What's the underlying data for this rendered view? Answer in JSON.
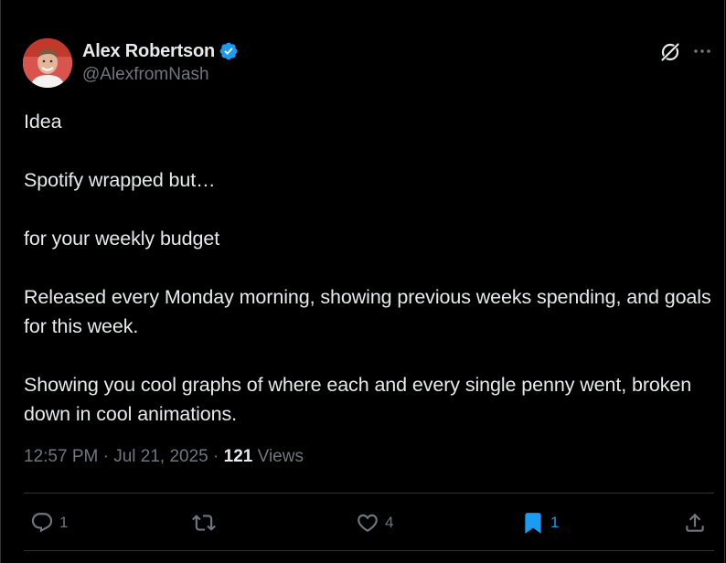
{
  "tweet": {
    "author": {
      "display_name": "Alex Robertson",
      "handle": "@AlexfromNash",
      "verified": true,
      "verified_color": "#1d9bf0"
    },
    "paragraphs": [
      "Idea",
      "Spotify wrapped but…",
      "for your weekly budget",
      "Released every Monday morning, showing previous weeks spending, and goals for this week.",
      "Showing you cool graphs of where each and every single penny went, broken down in cool animations."
    ],
    "time": "12:57 PM",
    "separator": "·",
    "date": "Jul 21, 2025",
    "views_count": "121",
    "views_label": "Views"
  },
  "header_icons": {
    "grok": "grok-icon",
    "more": "more-icon"
  },
  "actions": {
    "reply": {
      "icon": "reply-icon",
      "count": "1"
    },
    "repost": {
      "icon": "repost-icon",
      "count": ""
    },
    "like": {
      "icon": "heart-icon",
      "count": "4"
    },
    "bookmark": {
      "icon": "bookmark-icon",
      "count": "1",
      "active": true
    },
    "share": {
      "icon": "share-icon"
    }
  },
  "colors": {
    "background": "#000000",
    "text": "#e7e9ea",
    "muted": "#71767b",
    "accent": "#1d9bf0",
    "border": "#2f3336"
  }
}
